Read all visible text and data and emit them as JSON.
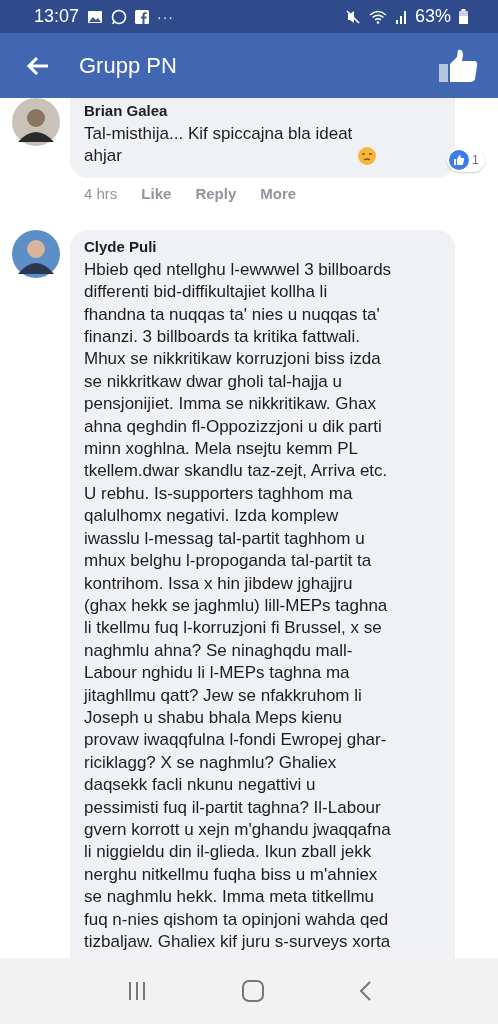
{
  "status_bar": {
    "time": "13:07",
    "more": "···",
    "battery": "63%"
  },
  "header": {
    "title": "Grupp PN"
  },
  "comments": [
    {
      "author": "Brian Galea",
      "text": "Tal-misthija... Kif spiccajna bla ideat\nahjar",
      "reactions": "1",
      "time": "4 hrs",
      "actions": [
        "Like",
        "Reply",
        "More"
      ]
    },
    {
      "author": "Clyde Puli",
      "text": "Hbieb qed ntellghu l-ewwwel 3 billboards\ndifferenti bid-diffikultajiet kollha li\nfhandna ta nuqqas ta' nies u nuqqas ta'\nfinanzi. 3 billboards ta kritika fattwali.\nMhux se nikkritikaw korruzjoni biss izda\nse nikkritkaw dwar gholi tal-hajja u\npensjonijiet. Imma se nikkritikaw. Ghax\nahna qeghdin fl-Oppozizzjoni u dik parti\nminn xoghlna. Mela nsejtu kemm PL\ntkellem.dwar skandlu taz-zejt, Arriva etc.\nU rebhu. Is-supporters taghhom ma\nqalulhomx negativi. Izda komplew\niwasslu l-messag tal-partit taghhom u\nmhux belghu l-propoganda tal-partit ta\nkontrihom. Issa x hin jibdew jghajjru\n(ghax hekk se jaghmlu) lill-MEPs taghna\nli tkellmu fuq l-korruzjoni fi Brussel, x se\nnaghmlu ahna? Se ninaghqdu mall-\nLabour nghidu li l-MEPs taghna ma\njitaghllmu qatt? Jew se nfakkruhom li\nJoseph u shabu bhala Meps kienu\nprovaw iwaqqfulna l-fondi Ewropej ghar-\nriciklagg? X se naghmlu? Ghaliex\ndaqsekk facli nkunu negattivi u\npessimisti fuq il-partit taghna? Il-Labour\ngvern korrott u xejn m'ghandu jwaqqafna\nli niggieldu din il-glieda. Ikun zball jekk\nnerghu nitkellmu fuqha biss u m'ahniex\nse naghmlu hekk. Imma meta titkellmu\nfuq n-nies qishom ta opinjoni wahda qed\ntizbaljaw. Ghaliex kif juru s-surveys xorta"
    }
  ]
}
